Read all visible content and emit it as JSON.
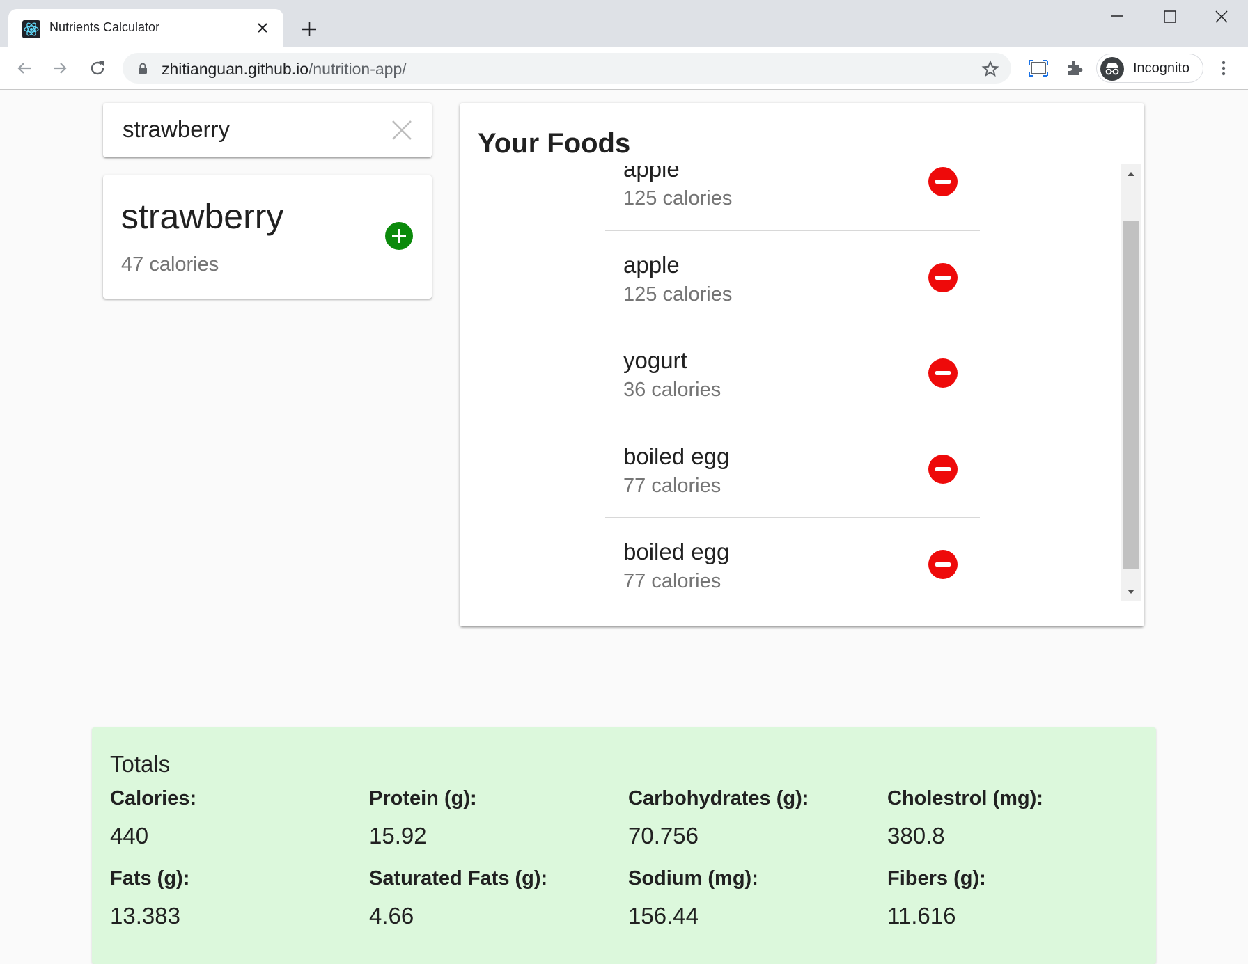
{
  "browser": {
    "tab_title": "Nutrients Calculator",
    "url_host": "zhitianguan.github.io",
    "url_path": "/nutrition-app/",
    "incognito_label": "Incognito"
  },
  "search": {
    "value": "strawberry",
    "placeholder": ""
  },
  "result": {
    "name": "strawberry",
    "calories": "47 calories"
  },
  "your_foods": {
    "title": "Your Foods",
    "items": [
      {
        "name": "apple",
        "calories": "125 calories"
      },
      {
        "name": "apple",
        "calories": "125 calories"
      },
      {
        "name": "yogurt",
        "calories": "36 calories"
      },
      {
        "name": "boiled egg",
        "calories": "77 calories"
      },
      {
        "name": "boiled egg",
        "calories": "77 calories"
      }
    ]
  },
  "totals": {
    "title": "Totals",
    "stats": [
      {
        "label": "Calories:",
        "value": "440"
      },
      {
        "label": "Protein (g):",
        "value": "15.92"
      },
      {
        "label": "Carbohydrates (g):",
        "value": "70.756"
      },
      {
        "label": "Cholestrol (mg):",
        "value": "380.8"
      },
      {
        "label": "Fats (g):",
        "value": "13.383"
      },
      {
        "label": "Saturated Fats (g):",
        "value": "4.66"
      },
      {
        "label": "Sodium (mg):",
        "value": "156.44"
      },
      {
        "label": "Fibers (g):",
        "value": "11.616"
      }
    ]
  },
  "colors": {
    "add_button": "#0b8a0b",
    "remove_button": "#ee0a0a",
    "totals_background": "#dcf8dc"
  },
  "icons": {
    "favicon": "react-atom-icon",
    "tab_close": "close-icon",
    "new_tab": "plus-icon",
    "back": "arrow-left-icon",
    "forward": "arrow-right-icon",
    "reload": "reload-icon",
    "lock": "lock-icon",
    "bookmark": "star-icon",
    "extensions": "puzzle-icon",
    "menu": "kebab-icon",
    "search_clear": "close-icon",
    "add": "plus-circle-icon",
    "remove": "minus-circle-icon"
  }
}
